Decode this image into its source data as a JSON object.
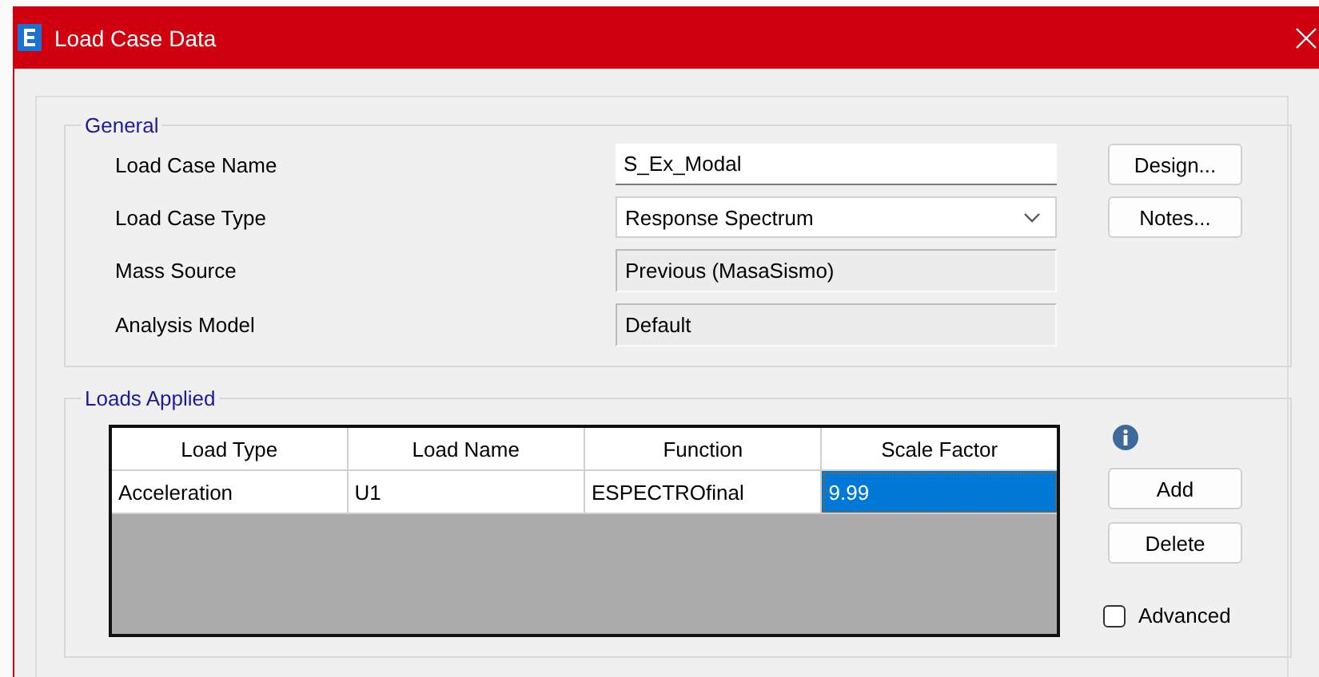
{
  "window": {
    "title": "Load Case Data"
  },
  "general": {
    "title": "General",
    "fields": [
      {
        "label": "Load Case Name",
        "kind": "text",
        "value": "S_Ex_Modal"
      },
      {
        "label": "Load Case Type",
        "kind": "dropdown",
        "value": "Response Spectrum"
      },
      {
        "label": "Mass Source",
        "kind": "readonly",
        "value": "Previous  (MasaSismo)"
      },
      {
        "label": "Analysis Model",
        "kind": "readonly",
        "value": "Default"
      }
    ],
    "buttons": [
      "Design...",
      "Notes..."
    ]
  },
  "loads_applied": {
    "title": "Loads Applied",
    "table": {
      "columns": [
        "Load Type",
        "Load Name",
        "Function",
        "Scale Factor"
      ],
      "rows": [
        [
          {
            "text": "Acceleration",
            "selected": false
          },
          {
            "text": "U1",
            "selected": false
          },
          {
            "text": "ESPECTROfinal",
            "selected": false
          },
          {
            "text": "9.99",
            "selected": true
          }
        ]
      ]
    },
    "buttons": [
      "Add",
      "Delete"
    ],
    "advanced": {
      "label": "Advanced",
      "checked": false
    }
  }
}
